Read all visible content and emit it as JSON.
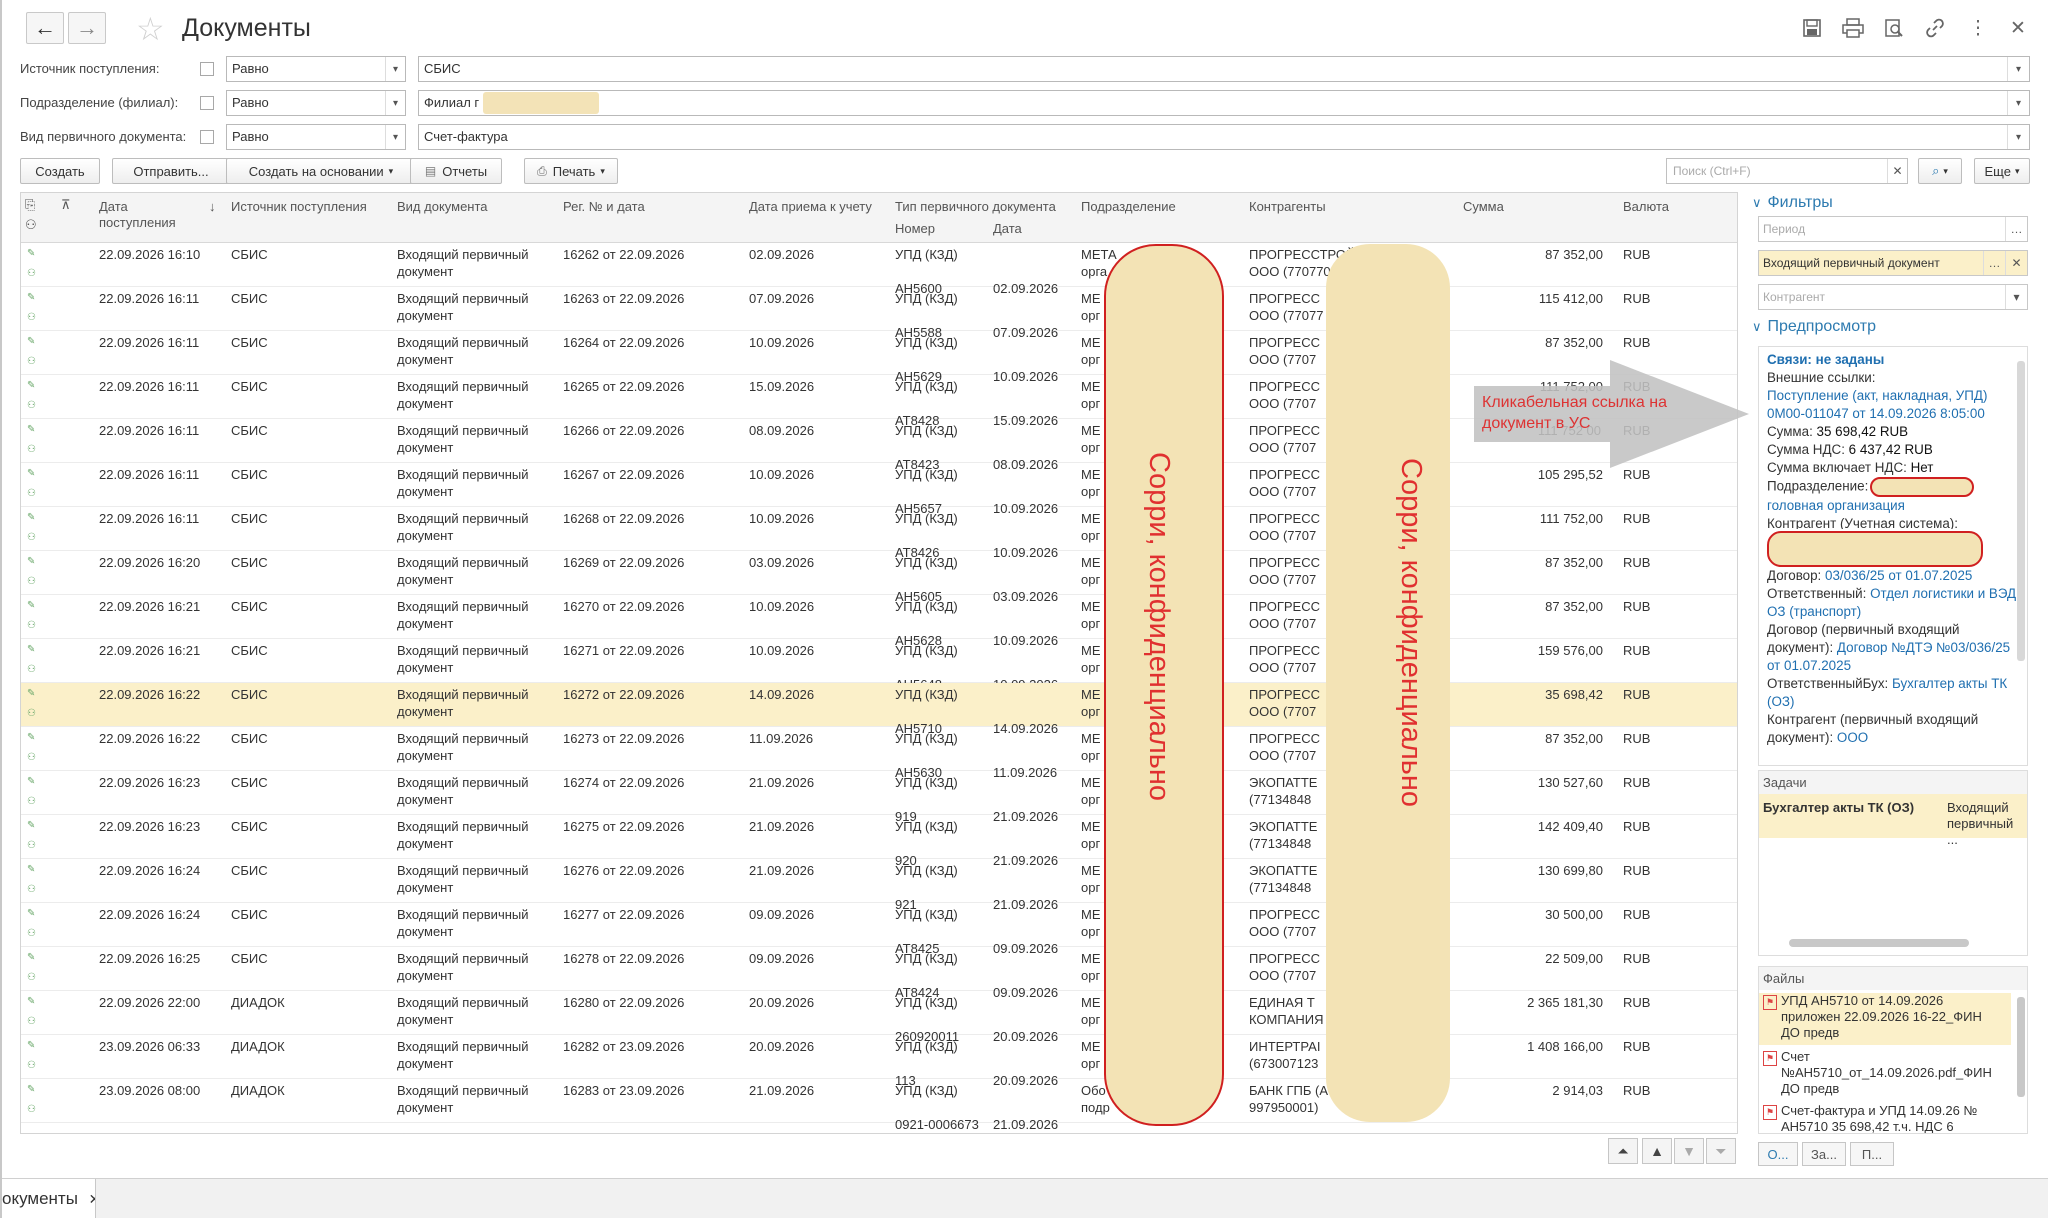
{
  "window": {
    "title": "Документы",
    "back_icon": "←",
    "forward_icon": "→",
    "star_icon": "☆"
  },
  "toolbar_icons": [
    "save-icon",
    "print-icon",
    "preview-icon",
    "link-icon",
    "more-icon",
    "close-icon"
  ],
  "filters": [
    {
      "label": "Источник поступления:",
      "condition": "Равно",
      "value": "СБИС",
      "blurred": false
    },
    {
      "label": "Подразделение (филиал):",
      "condition": "Равно",
      "value": "Филиал г",
      "blurred": true
    },
    {
      "label": "Вид первичного документа:",
      "condition": "Равно",
      "value": "Счет-фактура",
      "blurred": false
    }
  ],
  "commands": {
    "create": "Создать",
    "send": "Отправить...",
    "create_based": "Создать на основании",
    "reports": "Отчеты",
    "print": "Печать",
    "search_placeholder": "Поиск (Ctrl+F)",
    "more": "Еще"
  },
  "table": {
    "headers": {
      "date_received": "Дата поступления",
      "source": "Источник поступления",
      "doc_type": "Вид документа",
      "reg_number": "Рег. № и дата",
      "accept_date": "Дата приема к учету",
      "primary_type": "Тип первичного документа",
      "primary_number": "Номер",
      "primary_date": "Дата",
      "division": "Подразделение",
      "counterparty": "Контрагенты",
      "sum": "Сумма",
      "currency": "Валюта"
    },
    "rows": [
      {
        "date": "22.09.2026 16:10",
        "source": "СБИС",
        "doc1": "Входящий первичный",
        "doc2": "документ",
        "reg": "16262 от 22.09.2026",
        "accept": "02.09.2026",
        "ptype": "УПД (КЗД)",
        "pnum": "АН5600",
        "pdate": "02.09.2026",
        "div1": "МЕТА",
        "div2": "орга",
        "cp1": "ПРОГРЕССТРОЙ",
        "cp2": "ООО (770770",
        "sum": "87 352,00",
        "cur": "RUB"
      },
      {
        "date": "22.09.2026 16:11",
        "source": "СБИС",
        "doc1": "Входящий первичный",
        "doc2": "документ",
        "reg": "16263 от 22.09.2026",
        "accept": "07.09.2026",
        "ptype": "УПД (КЗД)",
        "pnum": "АН5588",
        "pdate": "07.09.2026",
        "div1": "МЕ",
        "div2": "орг",
        "cp1": "ПРОГРЕСС",
        "cp2": "ООО (77077",
        "sum": "115 412,00",
        "cur": "RUB"
      },
      {
        "date": "22.09.2026 16:11",
        "source": "СБИС",
        "doc1": "Входящий первичный",
        "doc2": "документ",
        "reg": "16264 от 22.09.2026",
        "accept": "10.09.2026",
        "ptype": "УПД (КЗД)",
        "pnum": "АН5629",
        "pdate": "10.09.2026",
        "div1": "МЕ",
        "div2": "орг",
        "cp1": "ПРОГРЕСС",
        "cp2": "ООО (7707",
        "sum": "87 352,00",
        "cur": "RUB"
      },
      {
        "date": "22.09.2026 16:11",
        "source": "СБИС",
        "doc1": "Входящий первичный",
        "doc2": "документ",
        "reg": "16265 от 22.09.2026",
        "accept": "15.09.2026",
        "ptype": "УПД (КЗД)",
        "pnum": "АТ8428",
        "pdate": "15.09.2026",
        "div1": "МЕ",
        "div2": "орг",
        "cp1": "ПРОГРЕСС",
        "cp2": "ООО (7707",
        "sum": "111 752,00",
        "cur": "RUB"
      },
      {
        "date": "22.09.2026 16:11",
        "source": "СБИС",
        "doc1": "Входящий первичный",
        "doc2": "документ",
        "reg": "16266 от 22.09.2026",
        "accept": "08.09.2026",
        "ptype": "УПД (КЗД)",
        "pnum": "АТ8423",
        "pdate": "08.09.2026",
        "div1": "МЕ",
        "div2": "орг",
        "cp1": "ПРОГРЕСС",
        "cp2": "ООО (7707",
        "sum": "",
        "cur": "RUB"
      },
      {
        "date": "22.09.2026 16:11",
        "source": "СБИС",
        "doc1": "Входящий первичный",
        "doc2": "документ",
        "reg": "16267 от 22.09.2026",
        "accept": "10.09.2026",
        "ptype": "УПД (КЗД)",
        "pnum": "АН5657",
        "pdate": "10.09.2026",
        "div1": "МЕ",
        "div2": "орг",
        "cp1": "ПРОГРЕСС",
        "cp2": "ООО (7707",
        "sum": "105 295,52",
        "cur": "RUB"
      },
      {
        "date": "22.09.2026 16:11",
        "source": "СБИС",
        "doc1": "Входящий первичный",
        "doc2": "документ",
        "reg": "16268 от 22.09.2026",
        "accept": "10.09.2026",
        "ptype": "УПД (КЗД)",
        "pnum": "АТ8426",
        "pdate": "10.09.2026",
        "div1": "МЕ",
        "div2": "орг",
        "cp1": "ПРОГРЕСС",
        "cp2": "ООО (7707",
        "sum": "111 752,00",
        "cur": "RUB"
      },
      {
        "date": "22.09.2026 16:20",
        "source": "СБИС",
        "doc1": "Входящий первичный",
        "doc2": "документ",
        "reg": "16269 от 22.09.2026",
        "accept": "03.09.2026",
        "ptype": "УПД (КЗД)",
        "pnum": "АН5605",
        "pdate": "03.09.2026",
        "div1": "МЕ",
        "div2": "орг",
        "cp1": "ПРОГРЕСС",
        "cp2": "ООО (7707",
        "sum": "87 352,00",
        "cur": "RUB"
      },
      {
        "date": "22.09.2026 16:21",
        "source": "СБИС",
        "doc1": "Входящий первичный",
        "doc2": "документ",
        "reg": "16270 от 22.09.2026",
        "accept": "10.09.2026",
        "ptype": "УПД (КЗД)",
        "pnum": "АН5628",
        "pdate": "10.09.2026",
        "div1": "МЕ",
        "div2": "орг",
        "cp1": "ПРОГРЕСС",
        "cp2": "ООО (7707",
        "sum": "87 352,00",
        "cur": "RUB"
      },
      {
        "date": "22.09.2026 16:21",
        "source": "СБИС",
        "doc1": "Входящий первичный",
        "doc2": "документ",
        "reg": "16271 от 22.09.2026",
        "accept": "10.09.2026",
        "ptype": "УПД (КЗД)",
        "pnum": "АН5648",
        "pdate": "10.09.2026",
        "div1": "МЕ",
        "div2": "орг",
        "cp1": "ПРОГРЕСС",
        "cp2": "ООО (7707",
        "sum": "159 576,00",
        "cur": "RUB"
      },
      {
        "date": "22.09.2026 16:22",
        "source": "СБИС",
        "doc1": "Входящий первичный",
        "doc2": "документ",
        "reg": "16272 от 22.09.2026",
        "accept": "14.09.2026",
        "ptype": "УПД (КЗД)",
        "pnum": "АН5710",
        "pdate": "14.09.2026",
        "div1": "МЕ",
        "div2": "орг",
        "cp1": "ПРОГРЕСС",
        "cp2": "ООО (7707",
        "sum": "35 698,42",
        "cur": "RUB",
        "selected": true
      },
      {
        "date": "22.09.2026 16:22",
        "source": "СБИС",
        "doc1": "Входящий первичный",
        "doc2": "документ",
        "reg": "16273 от 22.09.2026",
        "accept": "11.09.2026",
        "ptype": "УПД (КЗД)",
        "pnum": "АН5630",
        "pdate": "11.09.2026",
        "div1": "МЕ",
        "div2": "орг",
        "cp1": "ПРОГРЕСС",
        "cp2": "ООО (7707",
        "sum": "87 352,00",
        "cur": "RUB"
      },
      {
        "date": "22.09.2026 16:23",
        "source": "СБИС",
        "doc1": "Входящий первичный",
        "doc2": "документ",
        "reg": "16274 от 22.09.2026",
        "accept": "21.09.2026",
        "ptype": "УПД (КЗД)",
        "pnum": "919",
        "pdate": "21.09.2026",
        "div1": "МЕ",
        "div2": "орг",
        "cp1": "ЭКОПАТТЕ",
        "cp2": "(77134848",
        "sum": "130 527,60",
        "cur": "RUB"
      },
      {
        "date": "22.09.2026 16:23",
        "source": "СБИС",
        "doc1": "Входящий первичный",
        "doc2": "документ",
        "reg": "16275 от 22.09.2026",
        "accept": "21.09.2026",
        "ptype": "УПД (КЗД)",
        "pnum": "920",
        "pdate": "21.09.2026",
        "div1": "МЕ",
        "div2": "орг",
        "cp1": "ЭКОПАТТЕ",
        "cp2": "(77134848",
        "sum": "142 409,40",
        "cur": "RUB"
      },
      {
        "date": "22.09.2026 16:24",
        "source": "СБИС",
        "doc1": "Входящий первичный",
        "doc2": "документ",
        "reg": "16276 от 22.09.2026",
        "accept": "21.09.2026",
        "ptype": "УПД (КЗД)",
        "pnum": "921",
        "pdate": "21.09.2026",
        "div1": "МЕ",
        "div2": "орг",
        "cp1": "ЭКОПАТТЕ",
        "cp2": "(77134848",
        "sum": "130 699,80",
        "cur": "RUB"
      },
      {
        "date": "22.09.2026 16:24",
        "source": "СБИС",
        "doc1": "Входящий первичный",
        "doc2": "документ",
        "reg": "16277 от 22.09.2026",
        "accept": "09.09.2026",
        "ptype": "УПД (КЗД)",
        "pnum": "АТ8425",
        "pdate": "09.09.2026",
        "div1": "МЕ",
        "div2": "орг",
        "cp1": "ПРОГРЕСС",
        "cp2": "ООО (7707",
        "sum": "30 500,00",
        "cur": "RUB"
      },
      {
        "date": "22.09.2026 16:25",
        "source": "СБИС",
        "doc1": "Входящий первичный",
        "doc2": "документ",
        "reg": "16278 от 22.09.2026",
        "accept": "09.09.2026",
        "ptype": "УПД (КЗД)",
        "pnum": "АТ8424",
        "pdate": "09.09.2026",
        "div1": "МЕ",
        "div2": "орг",
        "cp1": "ПРОГРЕСС",
        "cp2": "ООО (7707",
        "sum": "22 509,00",
        "cur": "RUB"
      },
      {
        "date": "22.09.2026 22:00",
        "source": "ДИАДОК",
        "doc1": "Входящий первичный",
        "doc2": "документ",
        "reg": "16280 от 22.09.2026",
        "accept": "20.09.2026",
        "ptype": "УПД (КЗД)",
        "pnum": "260920011",
        "pdate": "20.09.2026",
        "div1": "МЕ",
        "div2": "орг",
        "cp1": "ЕДИНАЯ Т",
        "cp2": "КОМПАНИЯ",
        "sum": "2 365 181,30",
        "cur": "RUB"
      },
      {
        "date": "23.09.2026 06:33",
        "source": "ДИАДОК",
        "doc1": "Входящий первичный",
        "doc2": "документ",
        "reg": "16282 от 23.09.2026",
        "accept": "20.09.2026",
        "ptype": "УПД (КЗД)",
        "pnum": "113",
        "pdate": "20.09.2026",
        "div1": "МЕ",
        "div2": "орг",
        "cp1": "ИНТЕРТРАІ",
        "cp2": "(673007123",
        "sum": "1 408 166,00",
        "cur": "RUB"
      },
      {
        "date": "23.09.2026 08:00",
        "source": "ДИАДОК",
        "doc1": "Входящий первичный",
        "doc2": "документ",
        "reg": "16283 от 23.09.2026",
        "accept": "21.09.2026",
        "ptype": "УПД (КЗД)",
        "pnum": "0921-0006673",
        "pdate": "21.09.2026",
        "div1": "Обо",
        "div2": "подр",
        "cp1": "БАНК ГПБ (А",
        "cp2": "997950001)",
        "sum": "2 914,03",
        "cur": "RUB"
      }
    ]
  },
  "overlays": {
    "confidential_text": "Сорри, конфиденциально",
    "annotation": "Кликабельная ссылка на документ в УС",
    "partial_sum": "111 752 00"
  },
  "right_panel": {
    "filters_title": "Фильтры",
    "period_placeholder": "Период",
    "doc_type_value": "Входящий первичный документ",
    "counterparty_placeholder": "Контрагент",
    "preview_title": "Предпросмотр",
    "links_label": "Связи: не заданы",
    "external_links": "Внешние ссылки:",
    "receipt_link": "Поступление (акт, накладная, УПД) 0М00-011047 от 14.09.2026 8:05:00",
    "sum_label": "Сумма:",
    "sum_value": "35 698,42 RUB",
    "vat_label": "Сумма НДС:",
    "vat_value": "6 437,42 RUB",
    "vat_incl_label": "Сумма включает НДС:",
    "vat_incl_value": "Нет",
    "division_label": "Подразделение:",
    "division_value": "головная организация",
    "cp_label": "Контрагент (Учетная система):",
    "confidential_small": "сорри, конфиденциально",
    "contract_label": "Договор:",
    "contract_value": "03/036/25 от 01.07.2025",
    "responsible_label": "Ответственный:",
    "responsible_value": "Отдел логистики и ВЭД ОЗ (транспорт)",
    "primary_contract_label": "Договор (первичный входящий документ):",
    "primary_contract_value": "Договор №ДТЭ №03/036/25 от 01.07.2025",
    "resp_acc_label": "ОтветственныйБух:",
    "resp_acc_value": "Бухгалтер акты ТК (ОЗ)",
    "cp_primary_label": "Контрагент (первичный входящий документ):",
    "cp_primary_value": "ООО",
    "tasks_title": "Задачи",
    "task_name": "Бухгалтер акты ТК (ОЗ)",
    "task_type": "Входящий первичный ...",
    "files_title": "Файлы",
    "files": [
      {
        "l1": "УПД АН5710 от 14.09.2026",
        "l2": "приложен 22.09.2026 16-22_ФИН",
        "l3": "ДО предв"
      },
      {
        "l1": "Счет",
        "l2": "№АН5710_от_14.09.2026.pdf_ФИН",
        "l3": "ДО предв"
      },
      {
        "l1": "Счет-фактура и УПД 14.09.26 №",
        "l2": "АН5710 35 698,42 т.ч. НДС 6",
        "l3": ""
      }
    ],
    "btn1": "О...",
    "btn2": "За...",
    "btn3": "П..."
  },
  "bottom_tab": {
    "label": "окументы",
    "close": "✕"
  },
  "colors": {
    "accent": "#2e7bb0",
    "selected_row": "#fbf0c9",
    "cover": "#f3e3b5",
    "red": "#d02020"
  }
}
